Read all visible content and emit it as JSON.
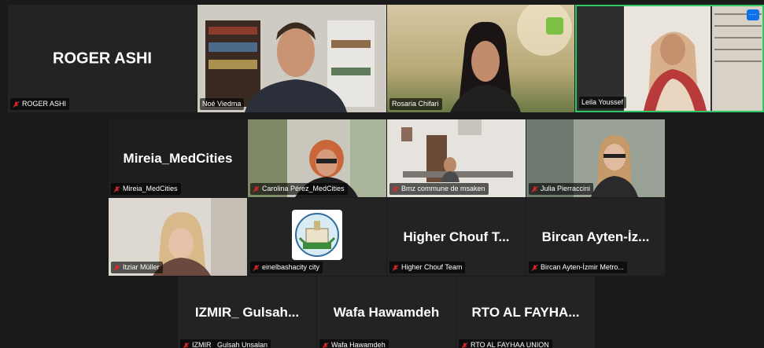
{
  "meeting": {
    "participants": [
      {
        "id": "p1",
        "display": "ROGER ASHI",
        "label": "ROGER ASHI",
        "muted": true,
        "video": false
      },
      {
        "id": "p2",
        "label": "Noé Viedma",
        "muted": false,
        "video": true
      },
      {
        "id": "p3",
        "label": "Rosaria Chifari",
        "muted": false,
        "video": true
      },
      {
        "id": "p4",
        "label": "Leila Youssef",
        "muted": false,
        "video": true,
        "active_speaker": true
      },
      {
        "id": "p5",
        "display": "Mireia_MedCities",
        "label": "Mireia_MedCities",
        "muted": true,
        "video": false
      },
      {
        "id": "p6",
        "label": "Carolina Pérez_MedCities",
        "muted": true,
        "video": true
      },
      {
        "id": "p7",
        "label": "Bmz commune de msaken",
        "muted": true,
        "video": true
      },
      {
        "id": "p8",
        "label": "Julia Pierraccini",
        "muted": true,
        "video": true
      },
      {
        "id": "p9",
        "label": "Itziar Müller",
        "muted": true,
        "video": true
      },
      {
        "id": "p10",
        "label": "einelbashacity city",
        "muted": true,
        "video": false,
        "avatar": "emblem"
      },
      {
        "id": "p11",
        "display": "Higher Chouf T...",
        "label": "Higher Chouf Team",
        "muted": true,
        "video": false
      },
      {
        "id": "p12",
        "display": "Bircan  Ayten-İz...",
        "label": "Bircan Ayten-İzmir Metro...",
        "muted": true,
        "video": false
      },
      {
        "id": "p13",
        "display": "IZMIR_  Gulsah...",
        "label": "IZMIR_ Gulsah Unsalan",
        "muted": true,
        "video": false
      },
      {
        "id": "p14",
        "display": "Wafa Hawamdeh",
        "label": "Wafa Hawamdeh",
        "muted": true,
        "video": false
      },
      {
        "id": "p15",
        "display": "RTO  AL  FAYHA...",
        "label": "RTO AL FAYHAA UNION",
        "muted": true,
        "video": false
      }
    ],
    "more_button_label": "···",
    "colors": {
      "active_border": "#2ec866",
      "mute_red": "#e02828",
      "tile_bg": "#1e1e1e",
      "stage_bg": "#1a1a1a"
    }
  }
}
